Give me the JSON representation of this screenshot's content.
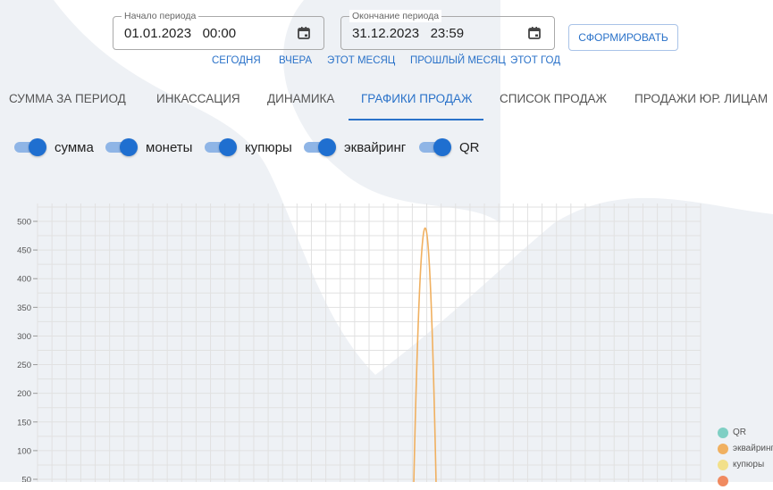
{
  "period": {
    "start": {
      "label": "Начало периода",
      "value": "01.01.2023   00:00",
      "icon": "calendar-icon"
    },
    "end": {
      "label": "Окончание периода",
      "value": "31.12.2023   23:59",
      "icon": "calendar-icon"
    },
    "submit_label": "СФОРМИРОВАТЬ",
    "quick": [
      "СЕГОДНЯ",
      "ВЧЕРА",
      "ЭТОТ МЕСЯЦ",
      "ПРОШЛЫЙ МЕСЯЦ",
      "ЭТОТ ГОД"
    ]
  },
  "tabs": [
    {
      "label": "СУММА ЗА ПЕРИОД",
      "active": false
    },
    {
      "label": "ИНКАССАЦИЯ",
      "active": false
    },
    {
      "label": "ДИНАМИКА",
      "active": false
    },
    {
      "label": "ГРАФИКИ ПРОДАЖ",
      "active": true
    },
    {
      "label": "СПИСОК ПРОДАЖ",
      "active": false
    },
    {
      "label": "ПРОДАЖИ ЮР. ЛИЦАМ",
      "active": false
    }
  ],
  "toggles": [
    {
      "label": "сумма",
      "on": true
    },
    {
      "label": "монеты",
      "on": true
    },
    {
      "label": "купюры",
      "on": true
    },
    {
      "label": "эквайринг",
      "on": true
    },
    {
      "label": "QR",
      "on": true
    }
  ],
  "colors": {
    "accent": "#2a72c9",
    "toggle_on": "#1f6fd0",
    "toggle_track": "#8fb5e6",
    "background_shape": "#eef1f5"
  },
  "chart_data": {
    "type": "line",
    "title": "",
    "xlabel": "",
    "ylabel": "",
    "yticks": [
      50,
      100,
      150,
      200,
      250,
      300,
      350,
      400,
      450,
      500
    ],
    "ylim": [
      0,
      530
    ],
    "grid": true,
    "legend_position": "right",
    "series": [
      {
        "name": "QR",
        "color": "#7fcfc4",
        "values": []
      },
      {
        "name": "эквайринг",
        "color": "#f0b060",
        "values": [
          {
            "x": 0,
            "y": 0
          },
          {
            "x": 1,
            "y": 530
          },
          {
            "x": 2,
            "y": 0
          }
        ]
      },
      {
        "name": "купюры",
        "color": "#f2e08a",
        "values": []
      }
    ]
  }
}
